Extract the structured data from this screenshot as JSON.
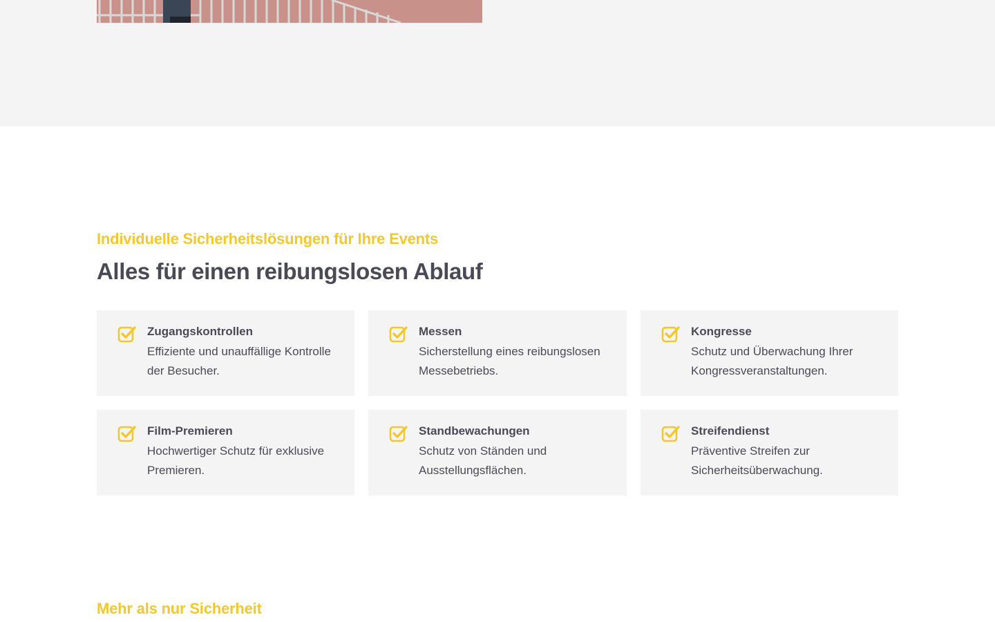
{
  "hero_image": {
    "icon": "event-photo"
  },
  "services": {
    "eyebrow": "Individuelle Sicherheitslösungen für Ihre Events",
    "heading": "Alles für einen reibungslosen Ablauf",
    "accent_color": "#f2c82a",
    "card_icon": "checkbox-check-icon",
    "items": [
      {
        "title": "Zugangskontrollen",
        "text": "Effiziente und unauffällige Kontrolle der Besucher."
      },
      {
        "title": "Messen",
        "text": "Sicherstellung eines reibungslosen Messebetriebs."
      },
      {
        "title": "Kongresse",
        "text": "Schutz und Überwachung Ihrer Kongressveranstaltungen."
      },
      {
        "title": "Film-Premieren",
        "text": "Hochwertiger Schutz für exklusive Premieren."
      },
      {
        "title": "Standbewachungen",
        "text": "Schutz von Ständen und Ausstellungsflächen."
      },
      {
        "title": "Streifendienst",
        "text": "Präventive Streifen zur Sicherheitsüberwachung."
      }
    ]
  },
  "next_section": {
    "eyebrow": "Mehr als nur Sicherheit"
  }
}
